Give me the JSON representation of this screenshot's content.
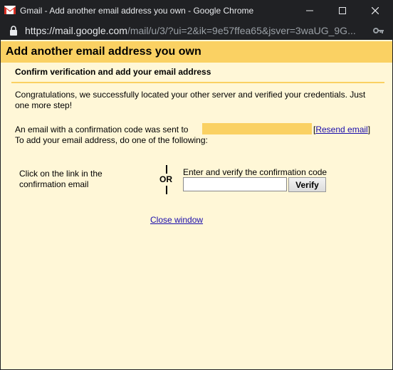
{
  "window": {
    "title": "Gmail - Add another email address you own - Google Chrome",
    "controls": {
      "minimize": "minimize-icon",
      "maximize": "maximize-icon",
      "close": "close-icon"
    }
  },
  "address_bar": {
    "host": "https://mail.google.com",
    "path": "/mail/u/3/?ui=2&ik=9e57ffea65&jsver=3waUG_9G..."
  },
  "dialog": {
    "title": "Add another email address you own",
    "section_heading": "Confirm verification and add your email address",
    "congrats_text": "Congratulations, we successfully located your other server and verified your credentials. Just one more step!",
    "sent_text": "An email with a confirmation code was sent to",
    "resend_open": "[",
    "resend_link": "Resend email",
    "resend_close": "]",
    "instructions": "To add your email address, do one of the following:",
    "option_link_text": "Click on the link in the confirmation email",
    "or_label": "OR",
    "code_label": "Enter and verify the confirmation code",
    "code_value": "",
    "verify_label": "Verify",
    "close_link": "Close window"
  },
  "colors": {
    "chrome_dark": "#202124",
    "header_yellow": "#fad163",
    "panel_cream": "#fff7d7",
    "link_blue": "#1a0dab"
  }
}
